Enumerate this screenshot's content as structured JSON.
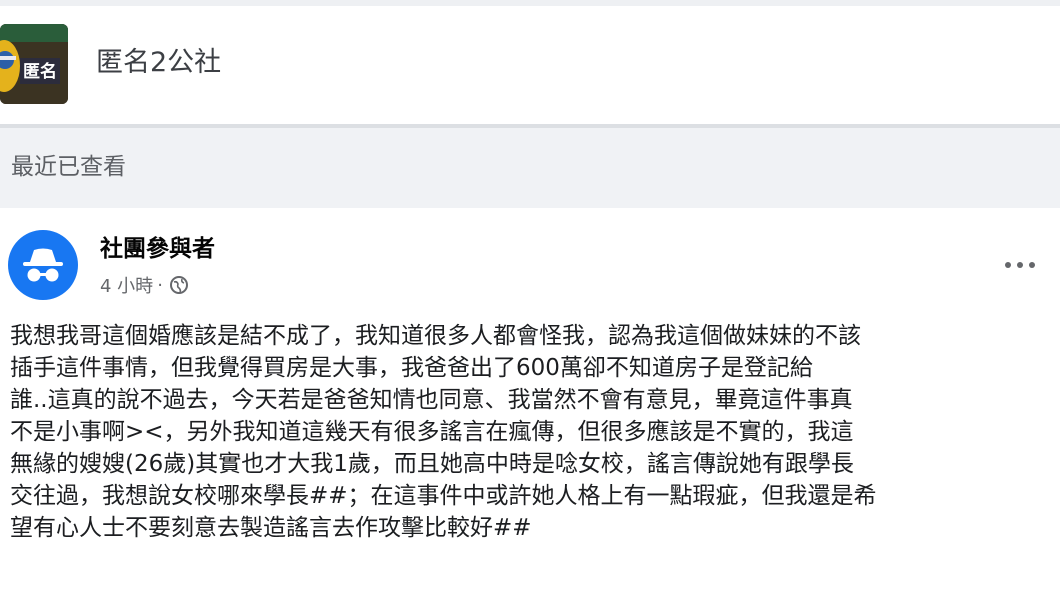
{
  "group": {
    "name": "匿名2公社",
    "thumbnail_text": "匿名"
  },
  "section": {
    "title": "最近已查看"
  },
  "post": {
    "author": "社團參與者",
    "time": "4 小時",
    "time_separator": "·",
    "privacy_icon": "globe-icon",
    "more_icon": "more-options-icon",
    "lines": [
      "我想我哥這個婚應該是結不成了，我知道很多人都會怪我，認為我這個做妹妹的不該",
      "插手這件事情，但我覺得買房是大事，￼我爸爸出了600萬卻不知道房子是登記給￼",
      "誰..這真的說不過去，今天若是爸爸知情也同意、我當然不會有意見，畢竟這件事真",
      "不是小事啊><，另外我知道這幾天有很多謠言在瘋傳，但很多應該是不實的，我這",
      "無緣的嫂嫂(26歲)其實也才大我1歲，而且她高中時是唸女校，謠言傳說她有跟學長",
      "交往過，我想說女校哪來學長##；在這事件中或許她人格上有一點瑕疵，但我還是希",
      "望有心人士不要刻意去製造謠言去作攻擊比較好##"
    ]
  },
  "colors": {
    "avatar_background": "#1877f2",
    "section_background": "#f0f2f5",
    "meta_text": "#65676b"
  }
}
